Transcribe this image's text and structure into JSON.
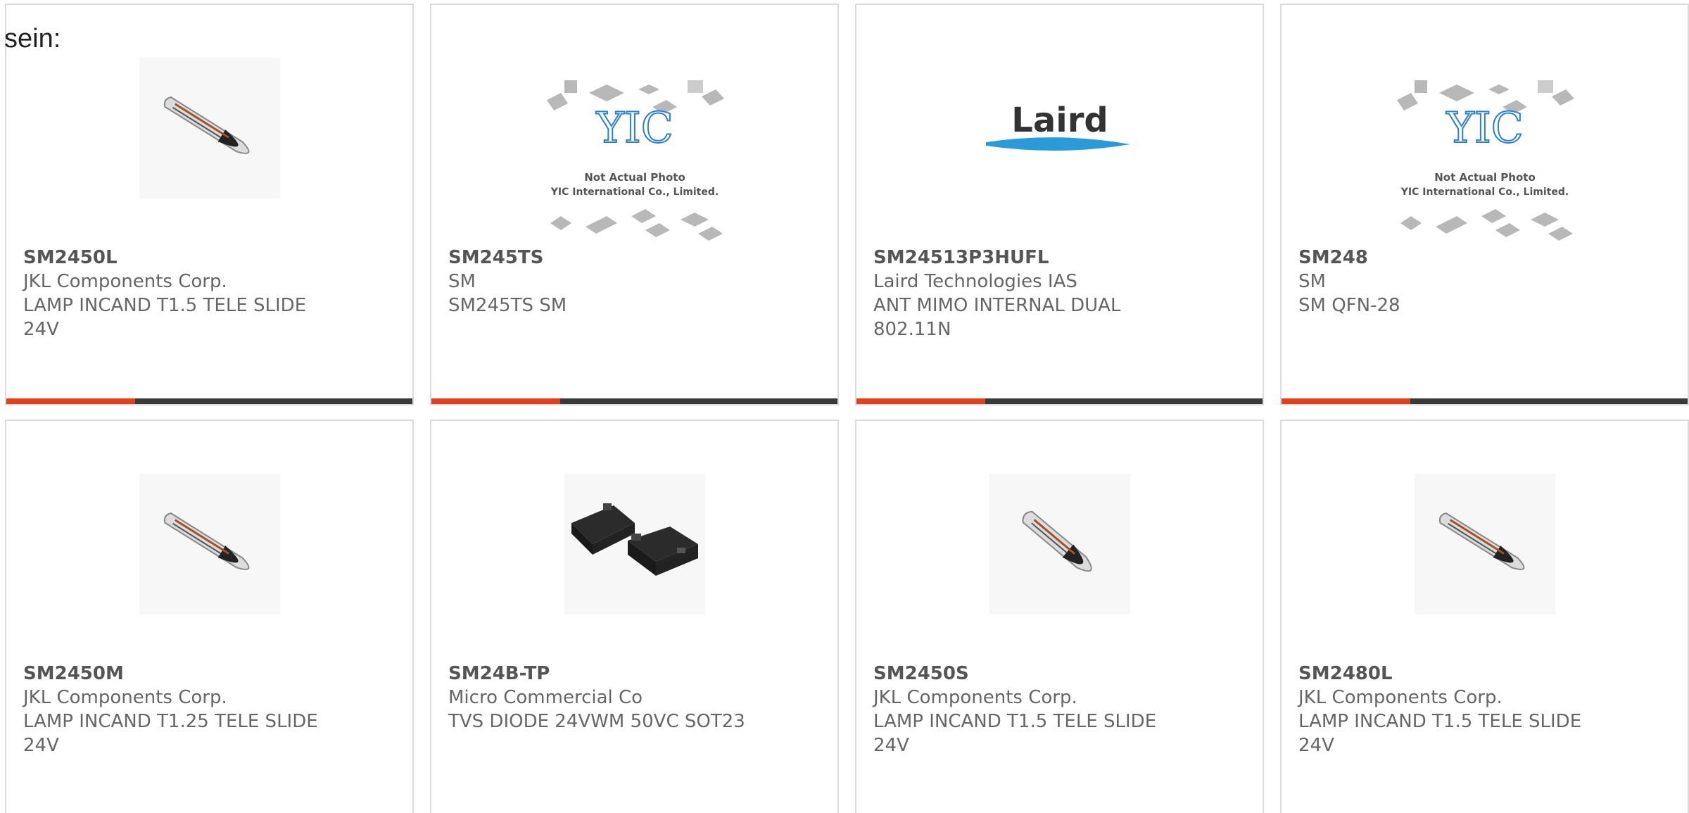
{
  "lead_text": "sein:",
  "accent_color": "#e0401c",
  "bar_color": "#3a3a3a",
  "cards": [
    {
      "image": "lamp-bulb-image",
      "part": "SM2450L",
      "manufacturer": "JKL Components Corp.",
      "description_1": "LAMP INCAND T1.5 TELE SLIDE",
      "description_2": "24V"
    },
    {
      "image": "yic-placeholder-image",
      "image_caption_1": "Not Actual Photo",
      "image_caption_2": "YIC International Co., Limited.",
      "part": "SM245TS",
      "manufacturer": "SM",
      "description_1": "SM245TS SM",
      "description_2": ""
    },
    {
      "image": "laird-logo-image",
      "image_caption_1": "Laird",
      "part": "SM24513P3HUFL",
      "manufacturer": "Laird Technologies IAS",
      "description_1": "ANT MIMO INTERNAL DUAL",
      "description_2": "802.11N"
    },
    {
      "image": "yic-placeholder-image",
      "image_caption_1": "Not Actual Photo",
      "image_caption_2": "YIC International Co., Limited.",
      "part": "SM248",
      "manufacturer": "SM",
      "description_1": "SM QFN-28",
      "description_2": ""
    },
    {
      "image": "lamp-bulb-image",
      "part": "SM2450M",
      "manufacturer": "JKL Components Corp.",
      "description_1": "LAMP INCAND T1.25 TELE SLIDE",
      "description_2": "24V"
    },
    {
      "image": "sot23-diode-image",
      "part": "SM24B-TP",
      "manufacturer": "Micro Commercial Co",
      "description_1": "TVS DIODE 24VWM 50VC SOT23",
      "description_2": ""
    },
    {
      "image": "lamp-bulb-image",
      "part": "SM2450S",
      "manufacturer": "JKL Components Corp.",
      "description_1": "LAMP INCAND T1.5 TELE SLIDE",
      "description_2": "24V"
    },
    {
      "image": "lamp-bulb-image",
      "part": "SM2480L",
      "manufacturer": "JKL Components Corp.",
      "description_1": "LAMP INCAND T1.5 TELE SLIDE",
      "description_2": "24V"
    }
  ]
}
